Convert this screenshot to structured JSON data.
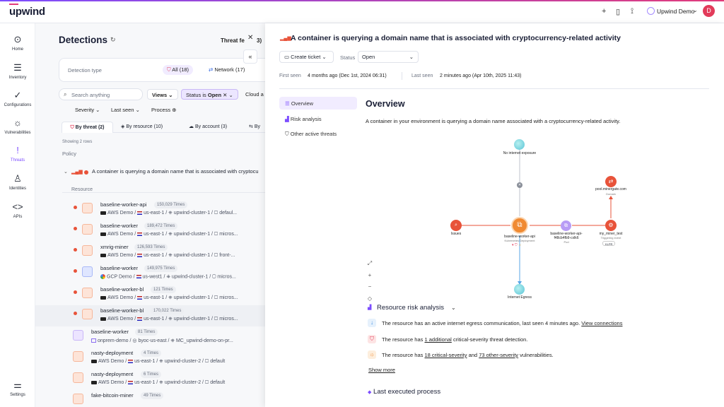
{
  "app": {
    "logo": "upwind",
    "user": "Upwind Demo",
    "avatar": "D"
  },
  "sidebar": [
    {
      "label": "Home",
      "icon": "home-icon"
    },
    {
      "label": "Inventory",
      "icon": "inventory-icon"
    },
    {
      "label": "Configurations",
      "icon": "check-icon"
    },
    {
      "label": "Vulnerabilities",
      "icon": "bug-icon"
    },
    {
      "label": "Threats",
      "icon": "alert-icon"
    },
    {
      "label": "Identities",
      "icon": "identity-icon"
    },
    {
      "label": "APIs",
      "icon": "code-icon"
    },
    {
      "label": "Settings",
      "icon": "settings-icon"
    }
  ],
  "detections": {
    "title": "Detections",
    "threat_feed": "Threat fe",
    "threat_feed_count": "3)",
    "type_label": "Detection type",
    "types": [
      {
        "label": "All (18)"
      },
      {
        "label": "Network (17)"
      }
    ],
    "search_placeholder": "Search anything",
    "views": "Views",
    "status_filter": "Status is",
    "status_value": "Open",
    "cloud": "Cloud a",
    "filters": [
      "Severity",
      "Last seen",
      "Process"
    ],
    "tabs": [
      "By threat (2)",
      "By resource (10)",
      "By account (3)",
      "By"
    ],
    "showing": "Showing 2 rows",
    "policy_header": "Policy",
    "group_title": "A container is querying a domain name that is associated with cryptocu",
    "resource_header": "Resource",
    "rows": [
      {
        "name": "baseline-worker-api",
        "count": "150,029 Times",
        "provider": "AWS Demo",
        "region": "us-east-1",
        "cluster": "upwind-cluster-1",
        "ns": "defaul..."
      },
      {
        "name": "baseline-worker",
        "count": "189,472 Times",
        "provider": "AWS Demo",
        "region": "us-east-1",
        "cluster": "upwind-cluster-1",
        "ns": "micros..."
      },
      {
        "name": "xmrig-miner",
        "count": "126,593 Times",
        "provider": "AWS Demo",
        "region": "us-east-1",
        "cluster": "upwind-cluster-1",
        "ns": "front-..."
      },
      {
        "name": "baseline-worker",
        "count": "149,975 Times",
        "provider": "GCP Demo",
        "region": "us-west1",
        "cluster": "upwind-cluster-1",
        "ns": "micros..."
      },
      {
        "name": "baseline-worker-bl",
        "count": "121 Times",
        "provider": "AWS Demo",
        "region": "us-east-1",
        "cluster": "upwind-cluster-1",
        "ns": "micros..."
      },
      {
        "name": "baseline-worker-bl",
        "count": "170,022 Times",
        "provider": "AWS Demo",
        "region": "us-east-1",
        "cluster": "upwind-cluster-1",
        "ns": "micros..."
      },
      {
        "name": "baseline-worker",
        "count": "81 Times",
        "provider": "onprem-demo",
        "region": "byoc-us-east",
        "cluster": "MC_upwind-demo-on-pr...",
        "ns": ""
      },
      {
        "name": "nasty-deployment",
        "count": "4 Times",
        "provider": "AWS Demo",
        "region": "us-east-1",
        "cluster": "upwind-cluster-2",
        "ns": "default"
      },
      {
        "name": "nasty-deployment",
        "count": "6 Times",
        "provider": "AWS Demo",
        "region": "us-east-1",
        "cluster": "upwind-cluster-2",
        "ns": "default"
      },
      {
        "name": "fake-bitcoin-miner",
        "count": "49 Times",
        "provider": "",
        "region": "",
        "cluster": "",
        "ns": ""
      }
    ]
  },
  "panel": {
    "title": "A container is querying a domain name that is associated with cryptocurrency-related activity",
    "create_ticket": "Create ticket",
    "status_label": "Status",
    "status_value": "Open",
    "first_seen_label": "First seen",
    "first_seen": "4 months ago (Dec 1st, 2024 06:31)",
    "last_seen_label": "Last seen",
    "last_seen": "2 minutes ago (Apr 10th, 2025 11:43)",
    "nav": [
      "Overview",
      "Risk analysis",
      "Other active threats"
    ],
    "overview_title": "Overview",
    "overview_text": "A container in your environment is querying a domain name associated with a cryptocurrency-related activity.",
    "graph": {
      "no_internet": "No internet exposure",
      "domain": "pool.minergate.com",
      "domain_sub": "Domain",
      "issues": "Issues",
      "deployment": "baseline-worker-api",
      "deployment_sub": "Kubernetes Deployment",
      "pod": "baseline-worker-api-",
      "pod2": "f48cb4fb9-cxlk6",
      "pod_sub": "Pod",
      "event": "my_miner_test",
      "event_sub": "Triggering event",
      "event_badge": "KLPR",
      "egress": "Internet Egress"
    },
    "risk_title": "Resource risk analysis",
    "risk1": "The resource has an active internet egress communication, last seen 4 minutes ago.",
    "risk1_link": "View connections",
    "risk2_a": "The resource has",
    "risk2_link": "1 additional",
    "risk2_b": "critical-severity threat detection.",
    "risk3_a": "The resource has",
    "risk3_link1": "18 critical-severity",
    "risk3_mid": "and",
    "risk3_link2": "73 other-severity",
    "risk3_b": "vulnerabilities.",
    "show_more": "Show more",
    "last_process": "Last executed process"
  }
}
